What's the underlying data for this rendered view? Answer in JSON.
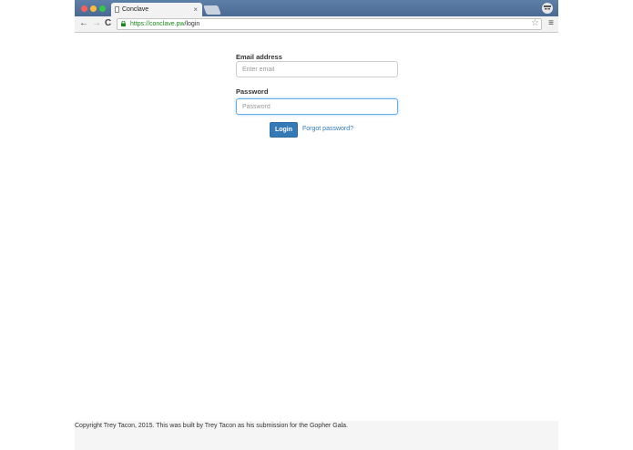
{
  "window": {
    "tab_title": "Conclave",
    "tab_close": "×"
  },
  "toolbar": {
    "back": "←",
    "forward": "→",
    "reload": "C",
    "url_scheme_host": "https://conclave.pw",
    "url_path": "/login",
    "star": "☆",
    "menu": "≡"
  },
  "form": {
    "email_label": "Email address",
    "email_placeholder": "Enter email",
    "email_value": "",
    "password_label": "Password",
    "password_placeholder": "Password",
    "password_value": "",
    "login_button": "Login",
    "forgot_link": "Forgot password?"
  },
  "footer": {
    "text": "Copyright Trey Tacon, 2015. This was built by Trey Tacon as his submission for the Gopher Gala."
  },
  "colors": {
    "accent": "#337ab7",
    "secure": "#1a8a1a"
  }
}
